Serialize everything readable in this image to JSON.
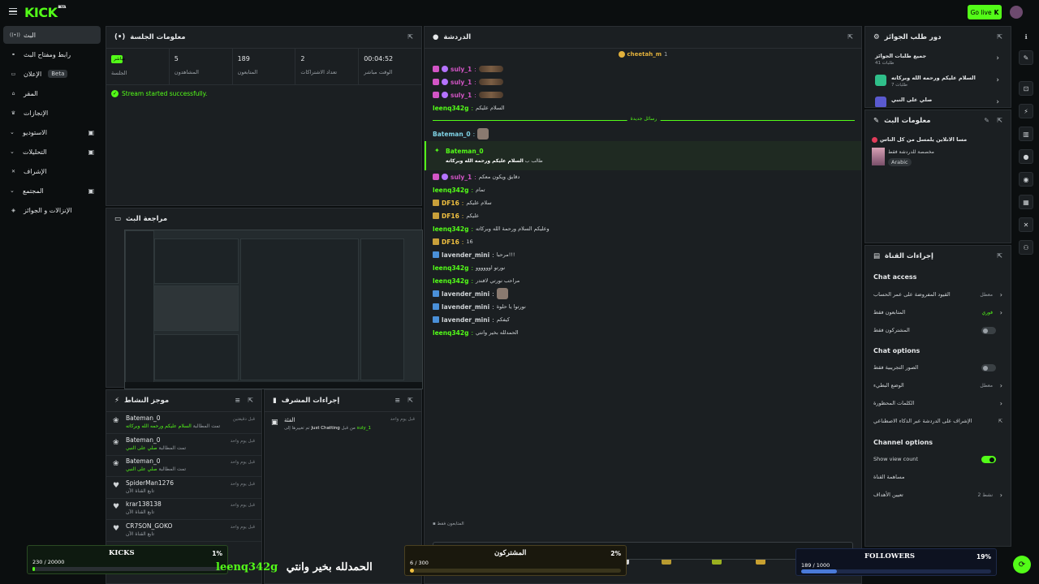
{
  "app": {
    "logo": "KICK",
    "logo_badge": "BETA",
    "go_live": "Go live"
  },
  "sidebar": {
    "items": [
      {
        "label": "البث",
        "icon": "broadcast-icon",
        "active": true
      },
      {
        "label": "رابط ومفتاح البث",
        "icon": "link-icon"
      },
      {
        "label": "الإعلان",
        "icon": "ad-icon",
        "badge": "Beta"
      },
      {
        "label": "المقر",
        "icon": "home-icon"
      },
      {
        "label": "الإنجازات",
        "icon": "trophy-icon"
      },
      {
        "label": "الاستوديو",
        "icon": "studio-icon",
        "expandable": true
      },
      {
        "label": "التحليلات",
        "icon": "analytics-icon",
        "expandable": true
      },
      {
        "label": "الإشراف",
        "icon": "moderation-icon"
      },
      {
        "label": "المجتمع",
        "icon": "community-icon",
        "expandable": true
      },
      {
        "label": "الإنزالات و الجوائز",
        "icon": "drops-icon"
      }
    ]
  },
  "session": {
    "title": "معلومات الجلسة",
    "stats": [
      {
        "value": "مباشر",
        "label": "الجلسة",
        "badge": true
      },
      {
        "value": "5",
        "label": "المشاهدون"
      },
      {
        "value": "189",
        "label": "المتابعون"
      },
      {
        "value": "2",
        "label": "تعداد الاشتراكات"
      },
      {
        "value": "00:04:52",
        "label": "الوقت مباشر"
      }
    ],
    "status": "Stream started successfully."
  },
  "preview": {
    "title": "مراجعة البث"
  },
  "activity": {
    "title": "موجز النشاط",
    "rows": [
      {
        "name": "Bateman_0",
        "desc_prefix": "تمت المطالبة",
        "desc_highlight": "السلام عليكم ورحمه الله وبركاته",
        "time": "قبل دقيقتين"
      },
      {
        "name": "Bateman_0",
        "desc_prefix": "تمت المطالبة",
        "desc_highlight": "صلي على النبي",
        "time": "قبل يوم واحد"
      },
      {
        "name": "Bateman_0",
        "desc_prefix": "تمت المطالبة",
        "desc_highlight": "صلي على النبي",
        "time": "قبل يوم واحد"
      },
      {
        "name": "SpiderMan1276",
        "desc_prefix": "تابع القناة الآن",
        "desc_highlight": "",
        "time": "قبل يوم واحد"
      },
      {
        "name": "krar138138",
        "desc_prefix": "تابع القناة الآن",
        "desc_highlight": "",
        "time": "قبل يوم واحد"
      },
      {
        "name": "CR7SON_GOKO",
        "desc_prefix": "تابع القناة الآن",
        "desc_highlight": "",
        "time": "قبل يوم واحد"
      }
    ]
  },
  "modactions": {
    "title": "إجراءات المشرف",
    "entry_title": "الفئة",
    "entry_text": "تم تغييرها إلى",
    "entry_value": "Just Chatting",
    "entry_by": "من قبل",
    "entry_user": "suly_1",
    "entry_time": "قبل يوم واحد"
  },
  "chat": {
    "title": "الدردشة",
    "pinned_user": "cheetah_m",
    "pinned_count": "1",
    "new_messages": "رسائل جديدة",
    "lines": [
      {
        "user": "suly_1",
        "text": "",
        "color": "#d355c6",
        "badges": [
          "pink",
          "purple"
        ],
        "blur": true
      },
      {
        "user": "suly_1",
        "text": "",
        "color": "#d355c6",
        "badges": [
          "pink",
          "purple"
        ],
        "blur": true
      },
      {
        "user": "suly_1",
        "text": "",
        "color": "#d355c6",
        "badges": [
          "pink",
          "purple"
        ],
        "blur": true
      },
      {
        "user": "leenq342g",
        "text": "السلام عليكم",
        "color": "#53fc18",
        "badges": []
      },
      {
        "user": "Bateman_0",
        "text": "",
        "color": "#7fd3e6",
        "badges": [],
        "emote": true
      },
      {
        "user": "suly_1",
        "text": "دقايق ويكون معكم",
        "color": "#d355c6",
        "badges": [
          "pink",
          "purple"
        ]
      },
      {
        "user": "leenq342g",
        "text": "تمام",
        "color": "#53fc18",
        "badges": []
      },
      {
        "user": "DF16",
        "text": "سلام عليكم",
        "color": "#f0c040",
        "badges": [
          "gold"
        ]
      },
      {
        "user": "DF16",
        "text": "عليكم",
        "color": "#f0c040",
        "badges": [
          "gold"
        ]
      },
      {
        "user": "leenq342g",
        "text": "وعليكم السلام ورحمة الله وبركاته",
        "color": "#53fc18",
        "badges": []
      },
      {
        "user": "DF16",
        "text": "16",
        "color": "#f0c040",
        "badges": [
          "gold"
        ]
      },
      {
        "user": "lavender_mini",
        "text": "مرحبا!!!",
        "color": "#cfd3d6",
        "badges": [
          "blue"
        ]
      },
      {
        "user": "leenq342g",
        "text": "نورتو اوووووو",
        "color": "#53fc18",
        "badges": []
      },
      {
        "user": "leenq342g",
        "text": "مراحب نورتي لافندر",
        "color": "#53fc18",
        "badges": []
      },
      {
        "user": "lavender_mini",
        "text": "",
        "color": "#cfd3d6",
        "badges": [
          "blue"
        ],
        "emote": true
      },
      {
        "user": "lavender_mini",
        "text": "نورتوا يا حلوة",
        "color": "#cfd3d6",
        "badges": [
          "blue"
        ]
      },
      {
        "user": "lavender_mini",
        "text": "كيفكم",
        "color": "#cfd3d6",
        "badges": [
          "blue"
        ]
      },
      {
        "user": "leenq342g",
        "text": "الحمدلله بخير وانتي",
        "color": "#53fc18",
        "badges": []
      }
    ],
    "highlight": {
      "user": "Bateman_0",
      "text_prefix": "طالب ب",
      "text": "السلام عليكم ورحمه الله وبركاته"
    },
    "followers_only": "المتابعون فقط"
  },
  "rewards": {
    "title": "دور طلب الجوائز",
    "items": [
      {
        "title": "جميع طلبات الجوائز",
        "sub": "طلبات 41"
      },
      {
        "title": "السلام عليكم ورحمه الله وبركاته",
        "sub": "طلبات 7"
      },
      {
        "title": "صلي على النبي",
        "sub": ""
      }
    ]
  },
  "streaminfo": {
    "title": "معلومات البث",
    "stream_title": "مسا الانلاين يلمسل من كل الناس",
    "category": "مخصصة للدردشة فقط",
    "language": "Arabic"
  },
  "channel": {
    "title": "إجراءات القناة",
    "chat_access_title": "Chat access",
    "chat_access": [
      {
        "label": "القيود المفروضة على عمر الحساب",
        "value": "معطل",
        "type": "select"
      },
      {
        "label": "المتابعون فقط",
        "value": "فوري",
        "type": "select",
        "green": true
      },
      {
        "label": "المشتركون فقط",
        "value": "",
        "type": "toggle",
        "on": false
      }
    ],
    "chat_options_title": "Chat options",
    "chat_options": [
      {
        "label": "الصور التجريبية فقط",
        "type": "toggle",
        "on": false
      },
      {
        "label": "الوضع البطيء",
        "value": "معطل",
        "type": "select"
      },
      {
        "label": "الكلمات المحظورة",
        "value": "",
        "type": "select"
      },
      {
        "label": "الإشراف على الدردشة عبر الذكاء الاصطناعي",
        "value": "",
        "type": "external"
      }
    ],
    "channel_options_title": "Channel options",
    "channel_options": [
      {
        "label": "Show view count",
        "type": "toggle",
        "on": true
      },
      {
        "label": "مساهمة القناة",
        "value": "",
        "type": "none"
      },
      {
        "label": "تعيين الأهداف",
        "value": "نشط 2",
        "type": "select"
      }
    ]
  },
  "goals": {
    "kicks": {
      "title": "KICKS",
      "percent": "1%",
      "count": "230 / 20000",
      "fill": 0.0115
    },
    "subs": {
      "title": "المشتركون",
      "percent": "2%",
      "count": "6 / 300",
      "fill": 0.02
    },
    "followers": {
      "title": "FOLLOWERS",
      "percent": "19%",
      "count": "189 / 1000",
      "fill": 0.189
    }
  },
  "overlay": {
    "user": "leenq342g",
    "text": "الحمدلله بخير وانتي"
  },
  "colors": {
    "accent": "#53fc18",
    "panel": "#1b1f22",
    "bg": "#0b0e0f"
  }
}
